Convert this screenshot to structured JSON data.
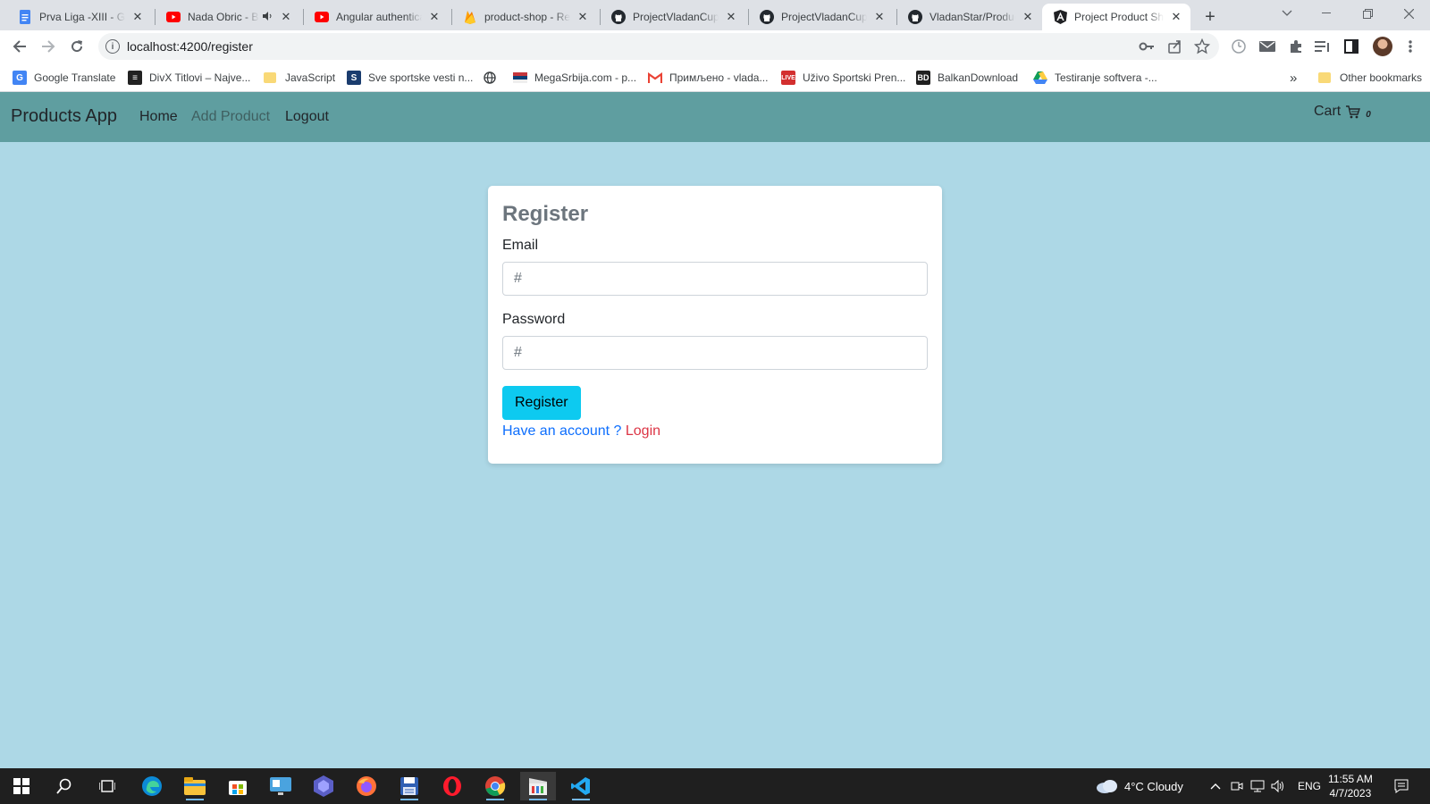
{
  "browser": {
    "tabs": [
      {
        "title": "Prva Liga -XIII - Google Docs",
        "icon": "google-docs-icon",
        "active": false
      },
      {
        "title": "Nada Obric - Bol",
        "icon": "youtube-icon",
        "active": false,
        "muted": true
      },
      {
        "title": "Angular authentication",
        "icon": "youtube-icon",
        "active": false
      },
      {
        "title": "product-shop - Realtime",
        "icon": "firebase-icon",
        "active": false
      },
      {
        "title": "ProjectVladanCuprija",
        "icon": "github-icon",
        "active": false
      },
      {
        "title": "ProjectVladanCuprija",
        "icon": "github-icon",
        "active": false
      },
      {
        "title": "VladanStar/Product",
        "icon": "github-icon",
        "active": false
      },
      {
        "title": "Project Product Shop",
        "icon": "angular-icon",
        "active": true
      }
    ],
    "new_tab_glyph": "+",
    "url": "localhost:4200/register",
    "bookmarks": [
      {
        "label": "Google Translate",
        "icon": "google-translate-icon"
      },
      {
        "label": "DivX Titlovi – Najve...",
        "icon": "divx-icon"
      },
      {
        "label": "JavaScript",
        "icon": "folder-icon"
      },
      {
        "label": "Sve sportske vesti n...",
        "icon": "sport-site-icon"
      },
      {
        "label": "",
        "icon": "globe-icon"
      },
      {
        "label": "MegaSrbija.com - p...",
        "icon": "megasrbija-icon"
      },
      {
        "label": "Примљено - vlada...",
        "icon": "gmail-icon"
      },
      {
        "label": "Uživo Sportski Pren...",
        "icon": "live-icon"
      },
      {
        "label": "BalkanDownload",
        "icon": "bd-icon"
      },
      {
        "label": "Testiranje softvera -...",
        "icon": "google-drive-icon"
      }
    ],
    "bookmarks_overflow": "»",
    "other_bookmarks": "Other bookmarks"
  },
  "app": {
    "brand": "Products App",
    "nav": {
      "home": "Home",
      "add_product": "Add Product",
      "logout": "Logout"
    },
    "cart": {
      "label": "Cart",
      "count": "0"
    }
  },
  "register": {
    "title": "Register",
    "email_label": "Email",
    "email_placeholder": "#",
    "password_label": "Password",
    "password_placeholder": "#",
    "submit": "Register",
    "have_account": "Have an account ?",
    "login_link": "Login"
  },
  "taskbar": {
    "weather": "4°C  Cloudy",
    "language": "ENG",
    "time": "11:55 AM",
    "date": "4/7/2023"
  },
  "colors": {
    "page_bg": "#add8e6",
    "navbar_bg": "#5f9ea0",
    "register_button": "#0dcaf0",
    "link_blue": "#0d6efd",
    "link_red": "#dc3545",
    "heading_gray": "#6c757d"
  }
}
